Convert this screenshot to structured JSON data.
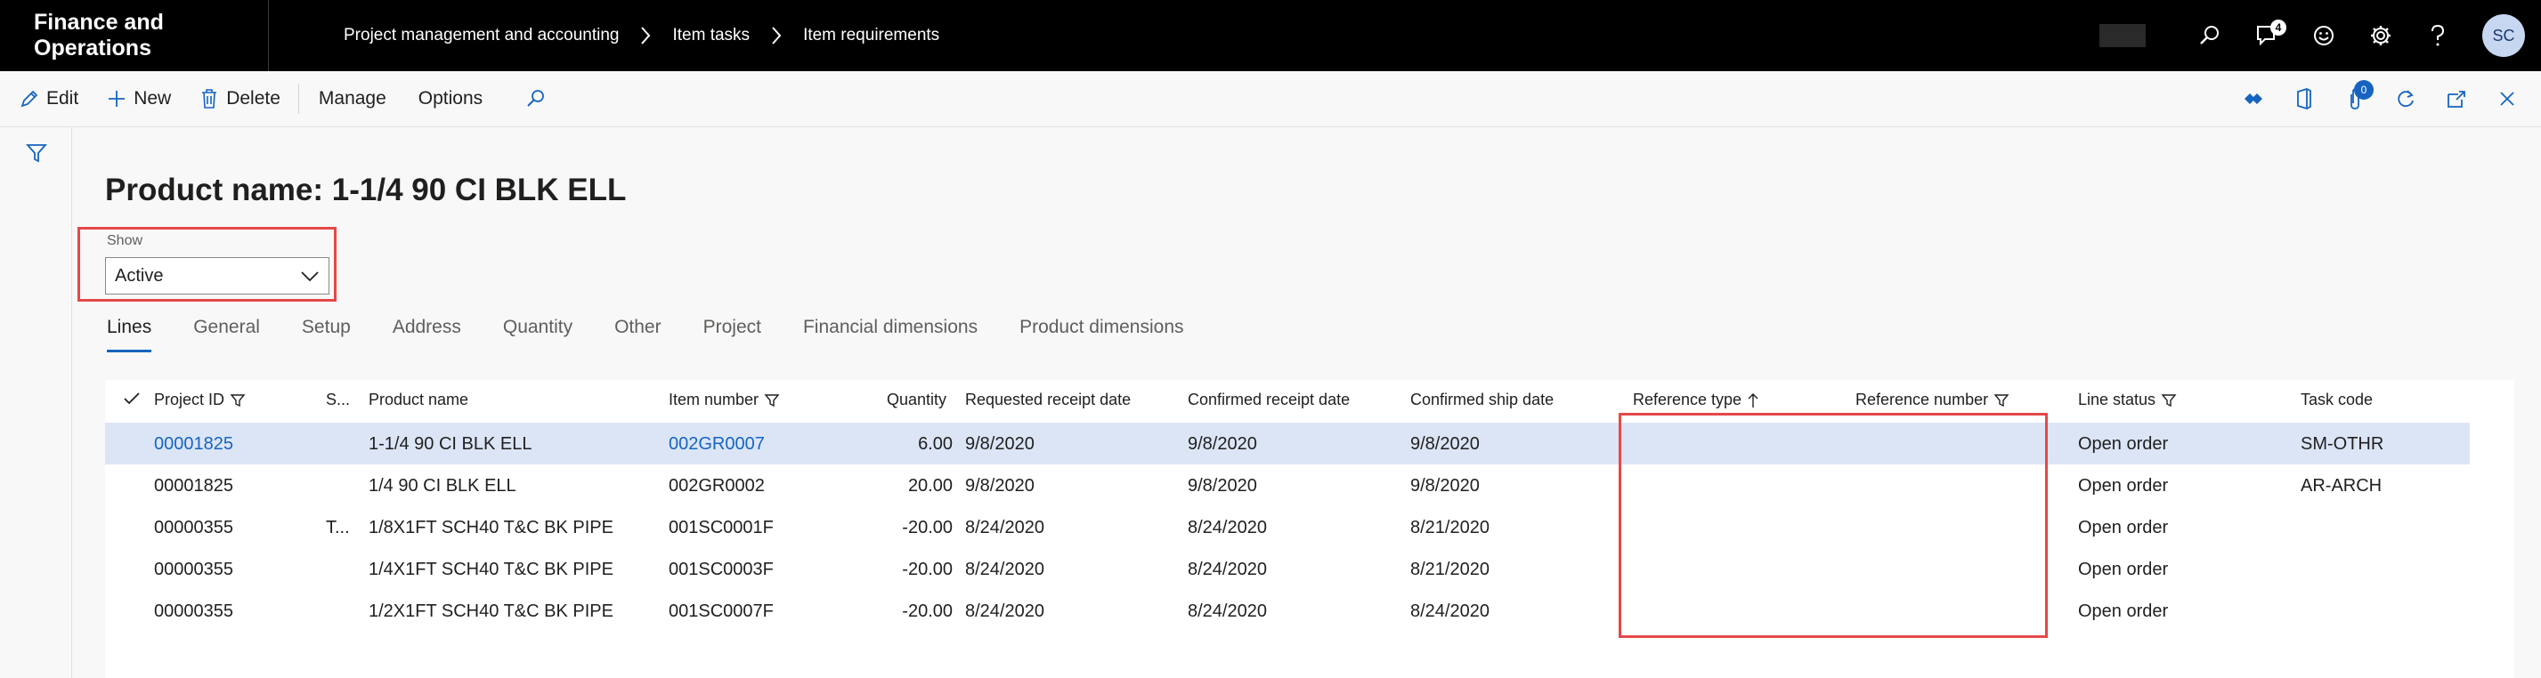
{
  "app": {
    "title": "Finance and Operations"
  },
  "breadcrumb": [
    "Project management and accounting",
    "Item tasks",
    "Item requirements"
  ],
  "topbar": {
    "notifications_count": "4",
    "user_initials": "SC"
  },
  "actionbar": {
    "edit": "Edit",
    "new": "New",
    "delete": "Delete",
    "manage": "Manage",
    "options": "Options",
    "attach_count": "0"
  },
  "page": {
    "title": "Product name: 1-1/4 90 CI BLK ELL"
  },
  "show": {
    "label": "Show",
    "value": "Active"
  },
  "tabs": [
    "Lines",
    "General",
    "Setup",
    "Address",
    "Quantity",
    "Other",
    "Project",
    "Financial dimensions",
    "Product dimensions"
  ],
  "grid": {
    "columns": {
      "project_id": "Project ID",
      "s": "S...",
      "product_name": "Product name",
      "item_number": "Item number",
      "quantity": "Quantity",
      "requested_receipt_date": "Requested receipt date",
      "confirmed_receipt_date": "Confirmed receipt date",
      "confirmed_ship_date": "Confirmed ship date",
      "reference_type": "Reference type",
      "reference_number": "Reference number",
      "line_status": "Line status",
      "task_code": "Task code"
    },
    "rows": [
      {
        "project_id": "00001825",
        "s": "",
        "product_name": "1-1/4 90 CI BLK ELL",
        "item_number": "002GR0007",
        "quantity": "6.00",
        "requested": "9/8/2020",
        "confirmed_receipt": "9/8/2020",
        "confirmed_ship": "9/8/2020",
        "reference_type": "",
        "reference_number": "",
        "line_status": "Open order",
        "task_code": "SM-OTHR"
      },
      {
        "project_id": "00001825",
        "s": "",
        "product_name": "1/4 90 CI BLK ELL",
        "item_number": "002GR0002",
        "quantity": "20.00",
        "requested": "9/8/2020",
        "confirmed_receipt": "9/8/2020",
        "confirmed_ship": "9/8/2020",
        "reference_type": "",
        "reference_number": "",
        "line_status": "Open order",
        "task_code": "AR-ARCH"
      },
      {
        "project_id": "00000355",
        "s": "T...",
        "product_name": "1/8X1FT SCH40 T&C BK PIPE",
        "item_number": "001SC0001F",
        "quantity": "-20.00",
        "requested": "8/24/2020",
        "confirmed_receipt": "8/24/2020",
        "confirmed_ship": "8/21/2020",
        "reference_type": "",
        "reference_number": "",
        "line_status": "Open order",
        "task_code": ""
      },
      {
        "project_id": "00000355",
        "s": "",
        "product_name": "1/4X1FT SCH40 T&C BK PIPE",
        "item_number": "001SC0003F",
        "quantity": "-20.00",
        "requested": "8/24/2020",
        "confirmed_receipt": "8/24/2020",
        "confirmed_ship": "8/21/2020",
        "reference_type": "",
        "reference_number": "",
        "line_status": "Open order",
        "task_code": ""
      },
      {
        "project_id": "00000355",
        "s": "",
        "product_name": "1/2X1FT SCH40 T&C BK PIPE",
        "item_number": "001SC0007F",
        "quantity": "-20.00",
        "requested": "8/24/2020",
        "confirmed_receipt": "8/24/2020",
        "confirmed_ship": "8/24/2020",
        "reference_type": "",
        "reference_number": "",
        "line_status": "Open order",
        "task_code": ""
      }
    ]
  }
}
